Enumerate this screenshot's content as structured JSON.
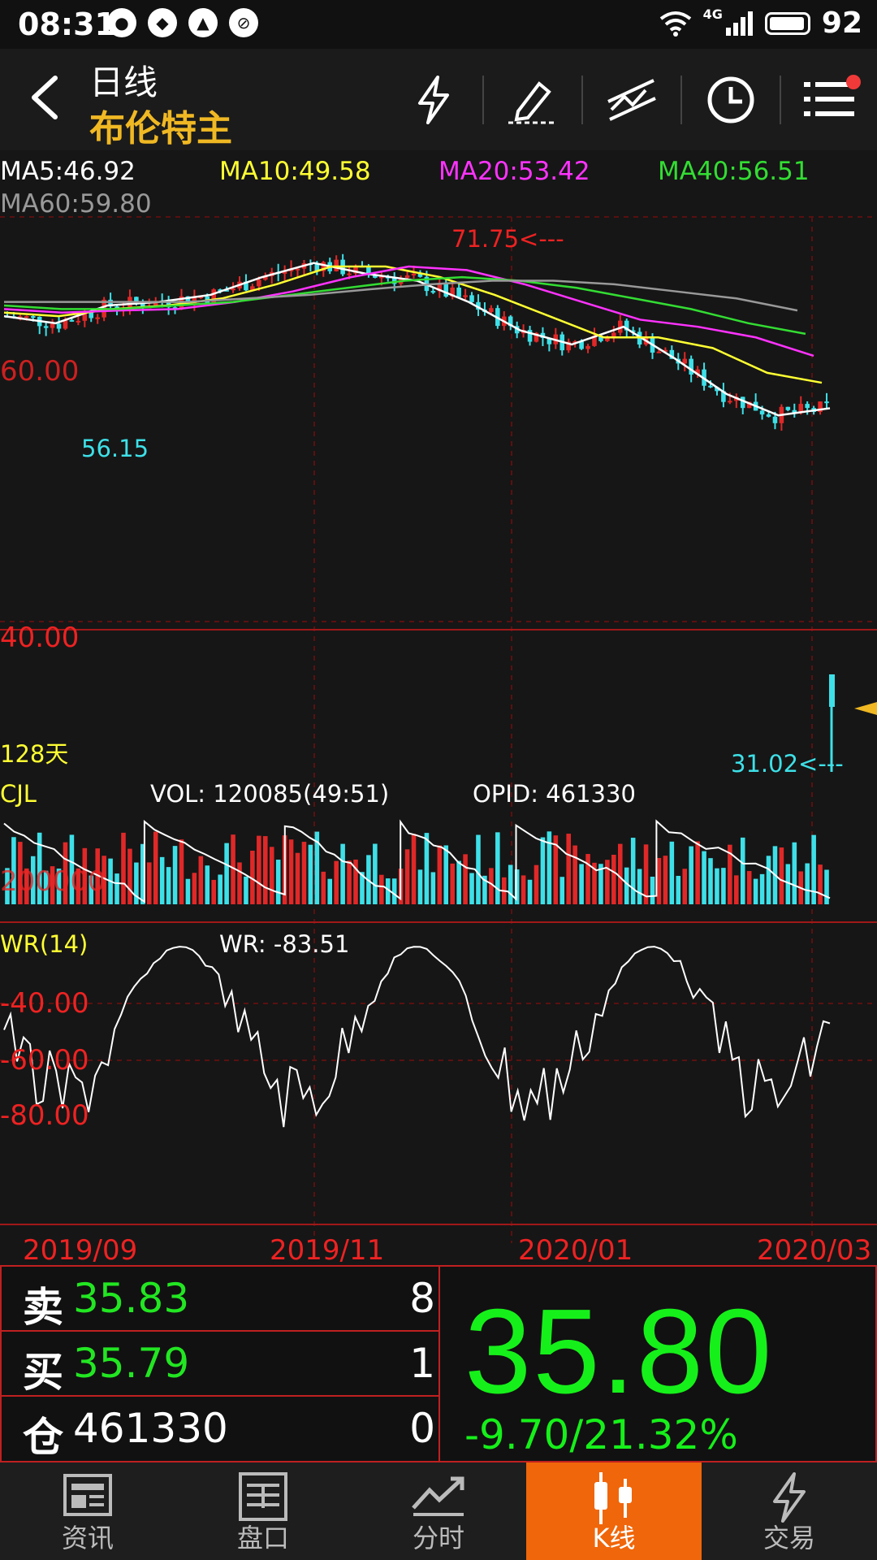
{
  "status": {
    "time": "08:31",
    "network": "4G",
    "battery": "92"
  },
  "header": {
    "period": "日线",
    "symbol": "布伦特主"
  },
  "ma": {
    "ma5": "MA5:46.92",
    "ma10": "MA10:49.58",
    "ma20": "MA20:53.42",
    "ma40": "MA40:56.51",
    "ma60": "MA60:59.80",
    "colors": {
      "ma5": "#ffffff",
      "ma10": "#ffff33",
      "ma20": "#ff33ff",
      "ma40": "#33dd33",
      "ma60": "#999999"
    }
  },
  "price_chart": {
    "high_label": "71.75<---",
    "low_label": "56.15",
    "axis_label_top": "60.00",
    "axis_label_mid": "40.00",
    "days_label": "128天",
    "min_label": "31.02<---"
  },
  "volume": {
    "title": "CJL",
    "vol": "VOL: 120085(49:51)",
    "opid": "OPID: 461330",
    "axis": "200000"
  },
  "wr": {
    "title": "WR(14)",
    "value": "WR: -83.51",
    "axis": [
      "-40.00",
      "-60.00",
      "-80.00"
    ]
  },
  "x_axis": [
    "2019/09",
    "2019/11",
    "2020/01",
    "2020/03"
  ],
  "quote": {
    "sell_key": "卖",
    "sell_price": "35.83",
    "sell_qty": "8",
    "buy_key": "买",
    "buy_price": "35.79",
    "buy_qty": "1",
    "pos_key": "仓",
    "pos_value": "461330",
    "pos_qty": "0",
    "last_price": "35.80",
    "change": "-9.70/21.32%"
  },
  "nav": [
    "资讯",
    "盘口",
    "分时",
    "K线",
    "交易"
  ],
  "chart_data": {
    "type": "line",
    "title": "",
    "y_range": [
      31.02,
      71.75
    ],
    "x_ticks": [
      "2019/09",
      "2019/11",
      "2020/01",
      "2020/03"
    ],
    "series": [
      {
        "name": "MA5",
        "values": [
          59,
          58,
          60.5,
          61,
          62,
          64.5,
          66.5,
          65,
          64,
          61,
          57,
          55,
          57.5,
          53,
          48,
          45,
          46
        ]
      },
      {
        "name": "MA10",
        "values": [
          59.5,
          59,
          60,
          60.5,
          61.5,
          63.5,
          66,
          66,
          64.5,
          62,
          59,
          56,
          56,
          54.5,
          51,
          49.6
        ]
      },
      {
        "name": "MA20",
        "values": [
          60,
          59.5,
          59.8,
          60,
          61,
          62.5,
          64.5,
          66,
          65.5,
          63.5,
          61,
          58.5,
          57.5,
          56,
          53.4
        ]
      },
      {
        "name": "MA40",
        "values": [
          60.5,
          60,
          60,
          60.5,
          61,
          62,
          63,
          64,
          64.5,
          64,
          63,
          61.5,
          60,
          58,
          56.5
        ]
      },
      {
        "name": "MA60",
        "values": [
          61,
          61,
          61,
          61,
          61.5,
          62,
          62.8,
          63.5,
          64,
          64,
          63.5,
          62.5,
          61.5,
          59.8
        ]
      }
    ]
  }
}
